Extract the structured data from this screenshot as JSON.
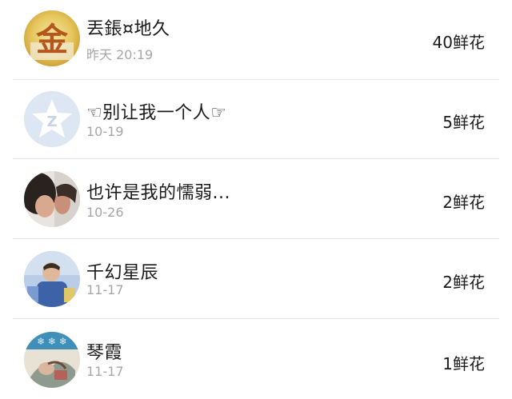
{
  "items": [
    {
      "name": "丟鋹¤地久",
      "time": "昨天 20:19",
      "flowers": "40鲜花",
      "avatar": "golden-character-avatar"
    },
    {
      "name": "☜别让我一个人☞",
      "time": "10-19",
      "flowers": "5鲜花",
      "avatar": "default-qq-avatar"
    },
    {
      "name": "也许是我的懦弱...",
      "time": "10-26",
      "flowers": "2鲜花",
      "avatar": "couple-photo-avatar"
    },
    {
      "name": "千幻星辰",
      "time": "11-17",
      "flowers": "2鲜花",
      "avatar": "child-photo-avatar"
    },
    {
      "name": "琴霞",
      "time": "11-17",
      "flowers": "1鲜花",
      "avatar": "painting-avatar"
    }
  ]
}
